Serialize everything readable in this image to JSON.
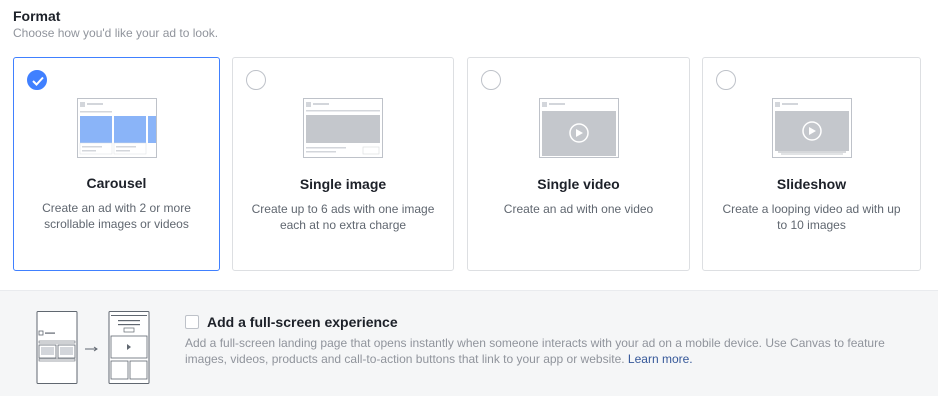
{
  "format": {
    "title": "Format",
    "subtitle": "Choose how you'd like your ad to look."
  },
  "cards": [
    {
      "name": "Carousel",
      "desc": "Create an ad with 2 or more scrollable images or videos",
      "selected": true
    },
    {
      "name": "Single image",
      "desc": "Create up to 6 ads with one image each at no extra charge",
      "selected": false
    },
    {
      "name": "Single video",
      "desc": "Create an ad with one video",
      "selected": false
    },
    {
      "name": "Slideshow",
      "desc": "Create a looping video ad with up to 10 images",
      "selected": false
    }
  ],
  "fullscreen": {
    "label": "Add a full-screen experience",
    "desc": "Add a full-screen landing page that opens instantly when someone interacts with your ad on a mobile device. Use Canvas to feature images, videos, products and call-to-action buttons that link to your app or website.",
    "link": "Learn more.",
    "checked": false
  },
  "colors": {
    "accent": "#4080ff",
    "link": "#365899",
    "carousel_blue": "#8ab4f8"
  },
  "icons": {
    "check": "check-icon",
    "play": "play-icon",
    "arrow": "arrow-right-icon"
  }
}
